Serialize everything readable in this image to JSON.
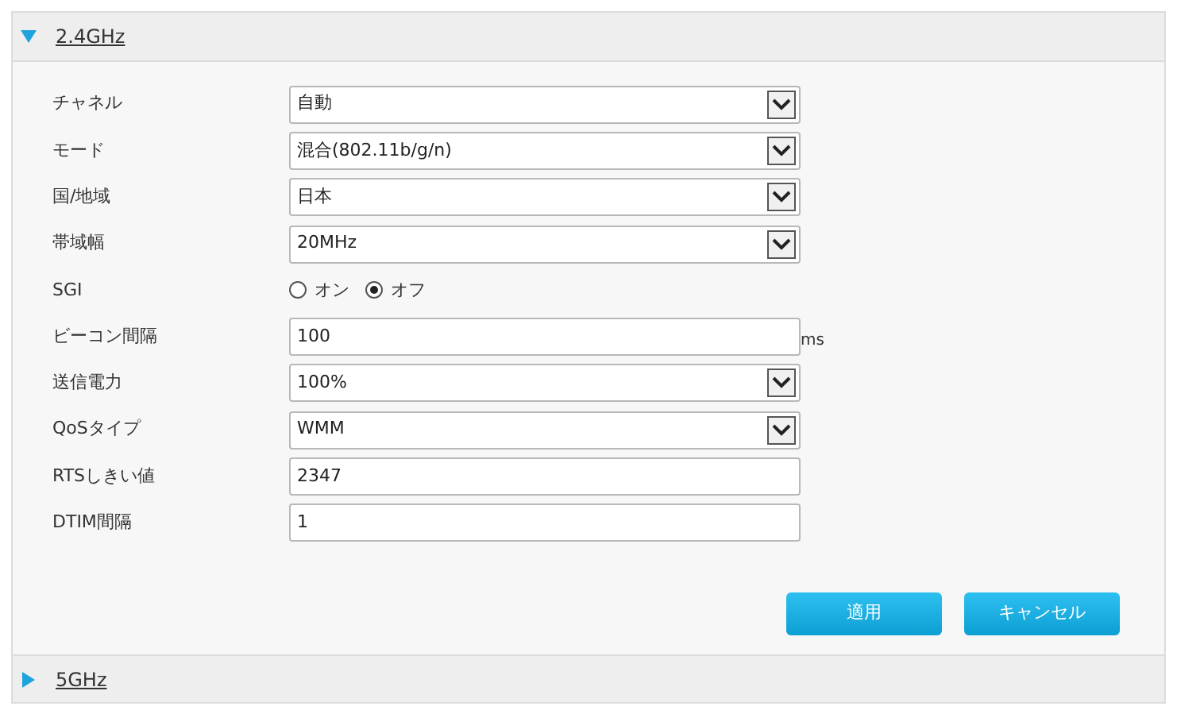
{
  "sections": [
    {
      "title": "2.4GHz",
      "expanded": true,
      "fields": [
        {
          "label": "チャネル",
          "kind": "select",
          "value": "自動"
        },
        {
          "label": "モード",
          "kind": "select",
          "value": "混合(802.11b/g/n)"
        },
        {
          "label": "国/地域",
          "kind": "select",
          "value": "日本"
        },
        {
          "label": "帯域幅",
          "kind": "select",
          "value": "20MHz"
        },
        {
          "label": "SGI",
          "kind": "radio",
          "options": [
            {
              "label": "オン",
              "selected": false
            },
            {
              "label": "オフ",
              "selected": true
            }
          ]
        },
        {
          "label": "ビーコン間隔",
          "kind": "text",
          "value": "100",
          "unit": "ms"
        },
        {
          "label": "送信電力",
          "kind": "select",
          "value": "100%"
        },
        {
          "label": "QoSタイプ",
          "kind": "select",
          "value": "WMM"
        },
        {
          "label": "RTSしきい値",
          "kind": "text",
          "value": "2347"
        },
        {
          "label": "DTIM間隔",
          "kind": "text",
          "value": "1"
        }
      ],
      "buttons": [
        "適用",
        "キャンセル"
      ]
    },
    {
      "title": "5GHz",
      "expanded": false
    }
  ]
}
